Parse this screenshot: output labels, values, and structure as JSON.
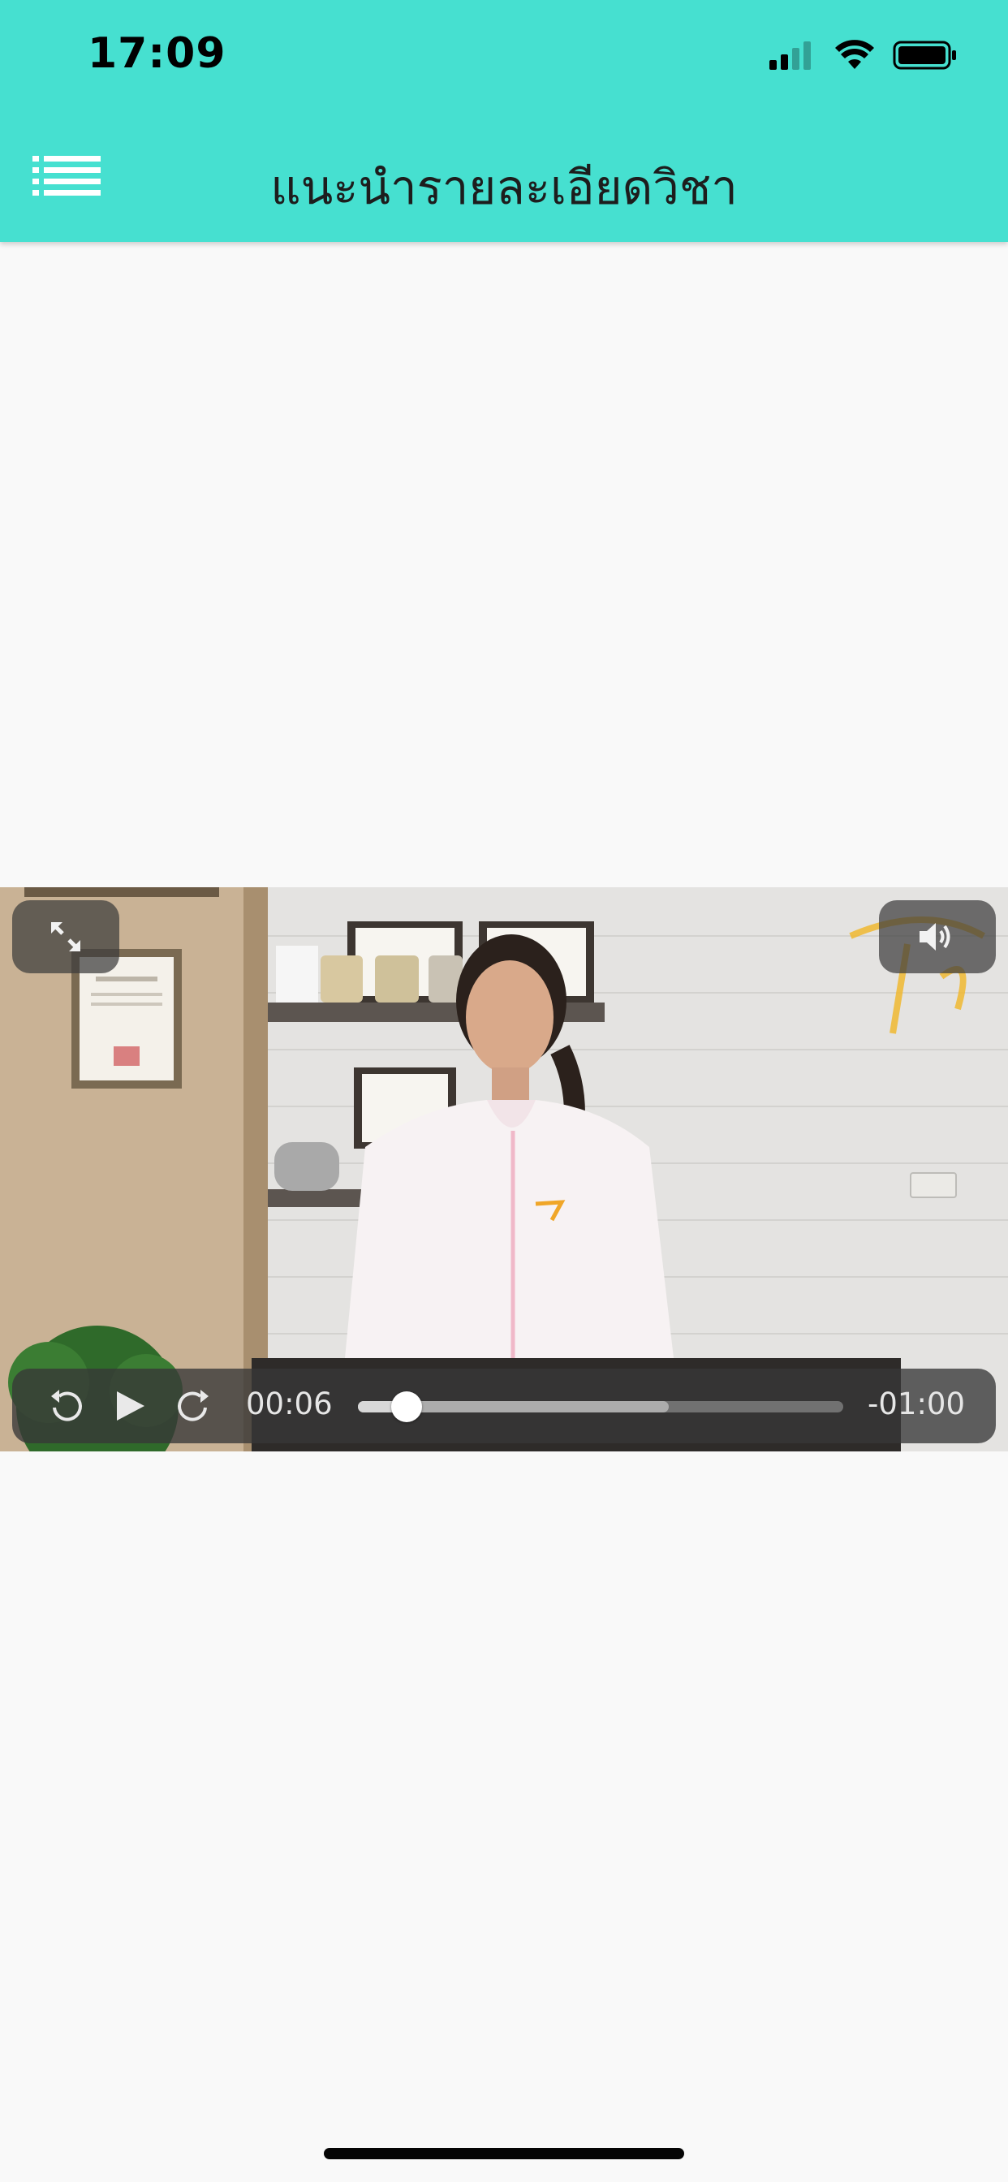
{
  "status_bar": {
    "time": "17:09",
    "icons": [
      "cellular-signal-icon",
      "wifi-icon",
      "battery-icon"
    ]
  },
  "header": {
    "title": "แนะนำรายละเอียดวิชา",
    "menu_icon": "list-menu-icon",
    "background_color": "#46e0d0"
  },
  "video": {
    "elapsed": "00:06",
    "remaining": "-01:00",
    "progress_fraction": 0.1,
    "buffered_fraction": 0.64,
    "controls": [
      "rewind-icon",
      "play-icon",
      "forward-icon",
      "fullscreen-icon",
      "volume-icon"
    ]
  }
}
